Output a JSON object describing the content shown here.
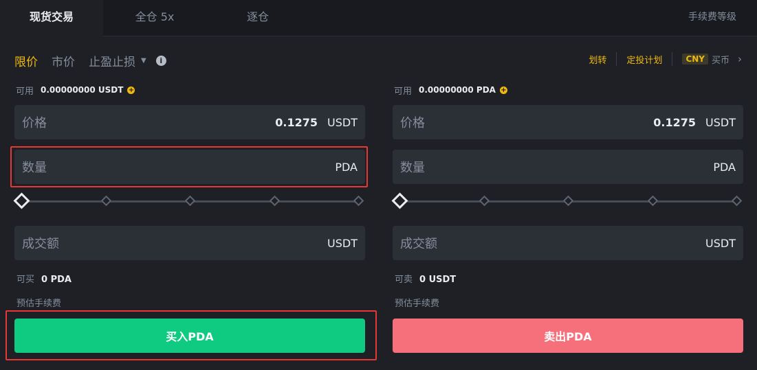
{
  "tabs": [
    {
      "label": "现货交易",
      "active": true
    },
    {
      "label": "全仓 5x",
      "active": false
    },
    {
      "label": "逐仓",
      "active": false
    }
  ],
  "fee_level_label": "手续费等级",
  "order_types": {
    "limit": "限价",
    "market": "市价",
    "stop_limit": "止盈止损",
    "info_icon": "i"
  },
  "right_links": {
    "transfer": "划转",
    "auto_invest": "定投计划",
    "currency_badge": "CNY",
    "buy_crypto": "买币",
    "chevron": "›"
  },
  "buy_panel": {
    "available_label": "可用",
    "available_value": "0.00000000 USDT",
    "price_label": "价格",
    "price_value": "0.1275",
    "price_unit": "USDT",
    "amount_label": "数量",
    "amount_unit": "PDA",
    "total_label": "成交额",
    "total_unit": "USDT",
    "max_label": "可买",
    "max_value": "0 PDA",
    "fee_label": "预估手续费",
    "button_label": "买入PDA"
  },
  "sell_panel": {
    "available_label": "可用",
    "available_value": "0.00000000 PDA",
    "price_label": "价格",
    "price_value": "0.1275",
    "price_unit": "USDT",
    "amount_label": "数量",
    "amount_unit": "PDA",
    "total_label": "成交额",
    "total_unit": "USDT",
    "max_label": "可卖",
    "max_value": "0 USDT",
    "fee_label": "预估手续费",
    "button_label": "卖出PDA"
  },
  "slider_level_percent": 0,
  "colors": {
    "accent": "#f0b90b",
    "buy": "#0ecb81",
    "sell": "#f6707b",
    "highlight": "#e53935",
    "background": "#1e2026"
  }
}
